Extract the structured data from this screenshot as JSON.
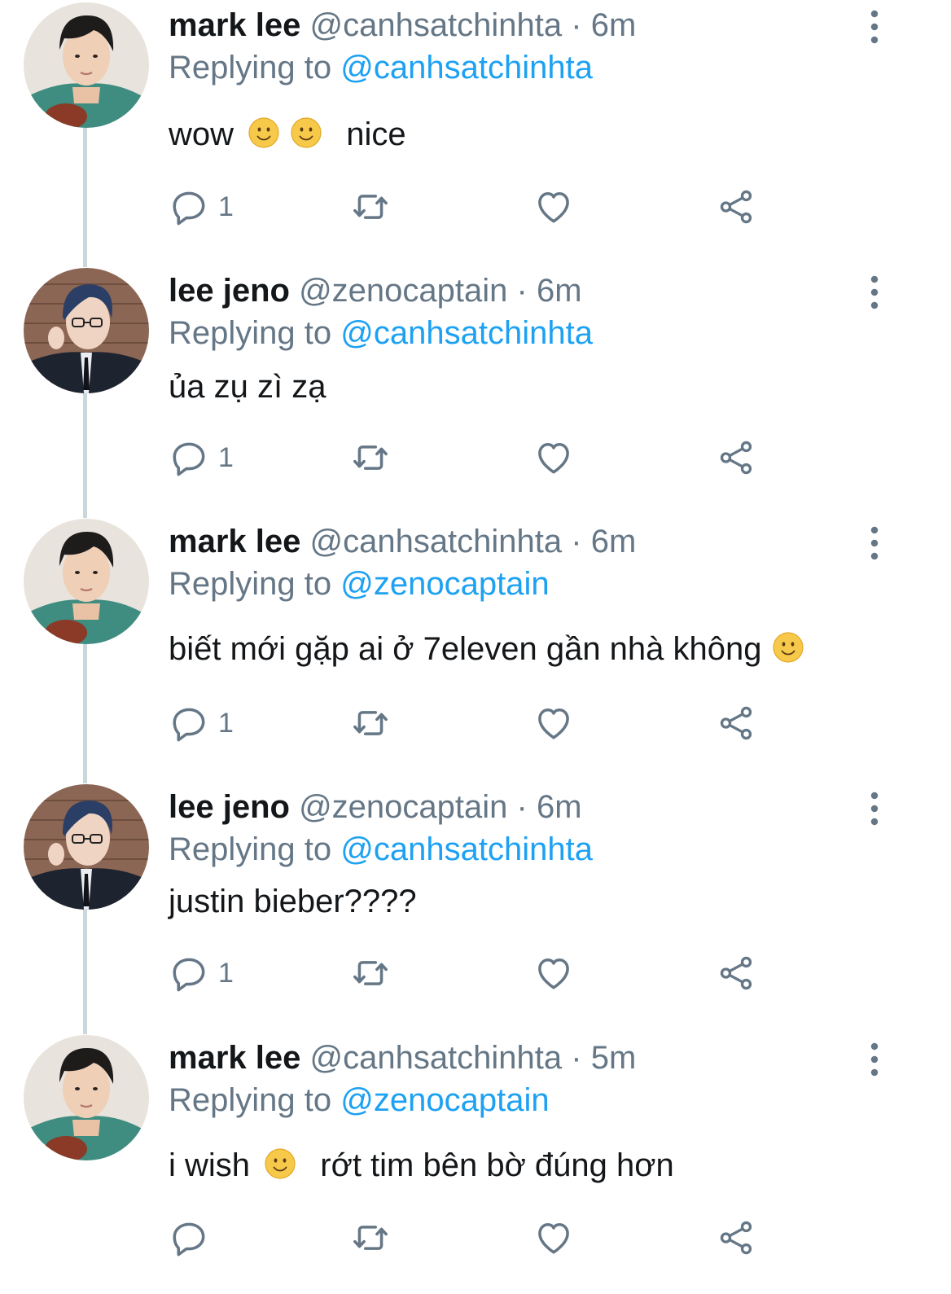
{
  "colors": {
    "name": "#14171a",
    "meta": "#657786",
    "mention": "#1da1f2",
    "thread_line": "#ccd6dd",
    "icon": "#657786",
    "emoji": "#f5c531"
  },
  "tweets": [
    {
      "name": "mark lee",
      "handle": "@canhsatchinhta",
      "time": "· 6m",
      "replying_label": "Replying to",
      "replying_to": "@canhsatchinhta",
      "text_parts": [
        "wow",
        "nice"
      ],
      "reply_count": "1",
      "avatar_icon": "avatar-mark-lee"
    },
    {
      "name": "lee jeno",
      "handle": "@zenocaptain",
      "time": "· 6m",
      "replying_label": "Replying to",
      "replying_to": "@canhsatchinhta",
      "text_parts": [
        "ủa zụ zì zạ"
      ],
      "reply_count": "1",
      "avatar_icon": "avatar-lee-jeno"
    },
    {
      "name": "mark lee",
      "handle": "@canhsatchinhta",
      "time": "· 6m",
      "replying_label": "Replying to",
      "replying_to": "@zenocaptain",
      "text_parts": [
        "biết mới gặp ai ở 7eleven gần nhà không"
      ],
      "reply_count": "1",
      "avatar_icon": "avatar-mark-lee"
    },
    {
      "name": "lee jeno",
      "handle": "@zenocaptain",
      "time": "· 6m",
      "replying_label": "Replying to",
      "replying_to": "@canhsatchinhta",
      "text_parts": [
        "justin bieber????"
      ],
      "reply_count": "1",
      "avatar_icon": "avatar-lee-jeno"
    },
    {
      "name": "mark lee",
      "handle": "@canhsatchinhta",
      "time": "· 5m",
      "replying_label": "Replying to",
      "replying_to": "@zenocaptain",
      "text_parts": [
        "i wish",
        "rớt tim bên bờ đúng hơn"
      ],
      "reply_count": "",
      "avatar_icon": "avatar-mark-lee"
    }
  ]
}
